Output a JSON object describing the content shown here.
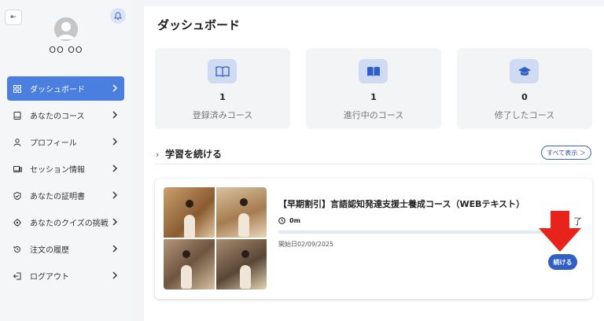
{
  "sidebar": {
    "collapse_icon": "collapse-left-icon",
    "bell_icon": "bell-icon",
    "username": "OO OO",
    "items": [
      {
        "label": "ダッシュボード",
        "icon": "grid-icon",
        "active": true
      },
      {
        "label": "あなたのコース",
        "icon": "book-icon"
      },
      {
        "label": "プロフィール",
        "icon": "user-icon"
      },
      {
        "label": "セッション情報",
        "icon": "devices-icon"
      },
      {
        "label": "あなたの証明書",
        "icon": "shield-check-icon"
      },
      {
        "label": "あなたのクイズの挑戦",
        "icon": "target-icon"
      },
      {
        "label": "注文の履歴",
        "icon": "history-icon"
      },
      {
        "label": "ログアウト",
        "icon": "logout-icon"
      }
    ]
  },
  "main": {
    "title": "ダッシュボード",
    "stats": [
      {
        "value": "1",
        "label": "登録済みコース",
        "icon": "open-book-icon"
      },
      {
        "value": "1",
        "label": "進行中のコース",
        "icon": "filled-book-icon"
      },
      {
        "value": "0",
        "label": "修了したコース",
        "icon": "graduation-cap-icon"
      }
    ],
    "continue_section": {
      "title": "学習を続ける",
      "see_all": "すべて表示 ＞"
    },
    "course": {
      "title": "【早期割引】言語認知発達支援士養成コース（WEBテキスト）",
      "time": "0m",
      "start_date": "開始日02/09/2025",
      "partial_text": "了",
      "progress": 0,
      "continue_label": "続ける"
    }
  },
  "colors": {
    "accent": "#4a7fe0",
    "button": "#2f5fc4",
    "arrow": "#e8231c"
  }
}
